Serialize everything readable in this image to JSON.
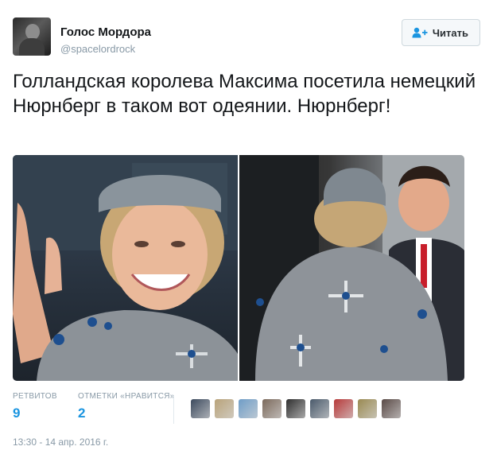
{
  "tweet": {
    "author_name": "Голос Мордора",
    "author_handle": "@spacelordrock",
    "follow_label": "Читать",
    "text": "Голландская королева Максима посетила немецкий Нюрнберг в таком вот одеянии. Нюрнберг!",
    "media": [
      {
        "name": "queen-smiling-photo"
      },
      {
        "name": "queen-back-photo"
      }
    ],
    "stats": {
      "retweets_label": "РЕТВИТОВ",
      "retweets": "9",
      "likes_label": "ОТМЕТКИ «НРАВИТСЯ»",
      "likes": "2"
    },
    "likers": [
      {
        "color": "#3c4a5e"
      },
      {
        "color": "#b9a37a"
      },
      {
        "color": "#6f9dc7"
      },
      {
        "color": "#7c6a5c"
      },
      {
        "color": "#2f2f2f"
      },
      {
        "color": "#4a5a6b"
      },
      {
        "color": "#b73a3a"
      },
      {
        "color": "#9a8a52"
      },
      {
        "color": "#5a4a46"
      }
    ],
    "timestamp": "13:30 - 14 апр. 2016 г."
  },
  "icons": {
    "follow": "person-plus-icon",
    "avatar": "user-avatar"
  }
}
